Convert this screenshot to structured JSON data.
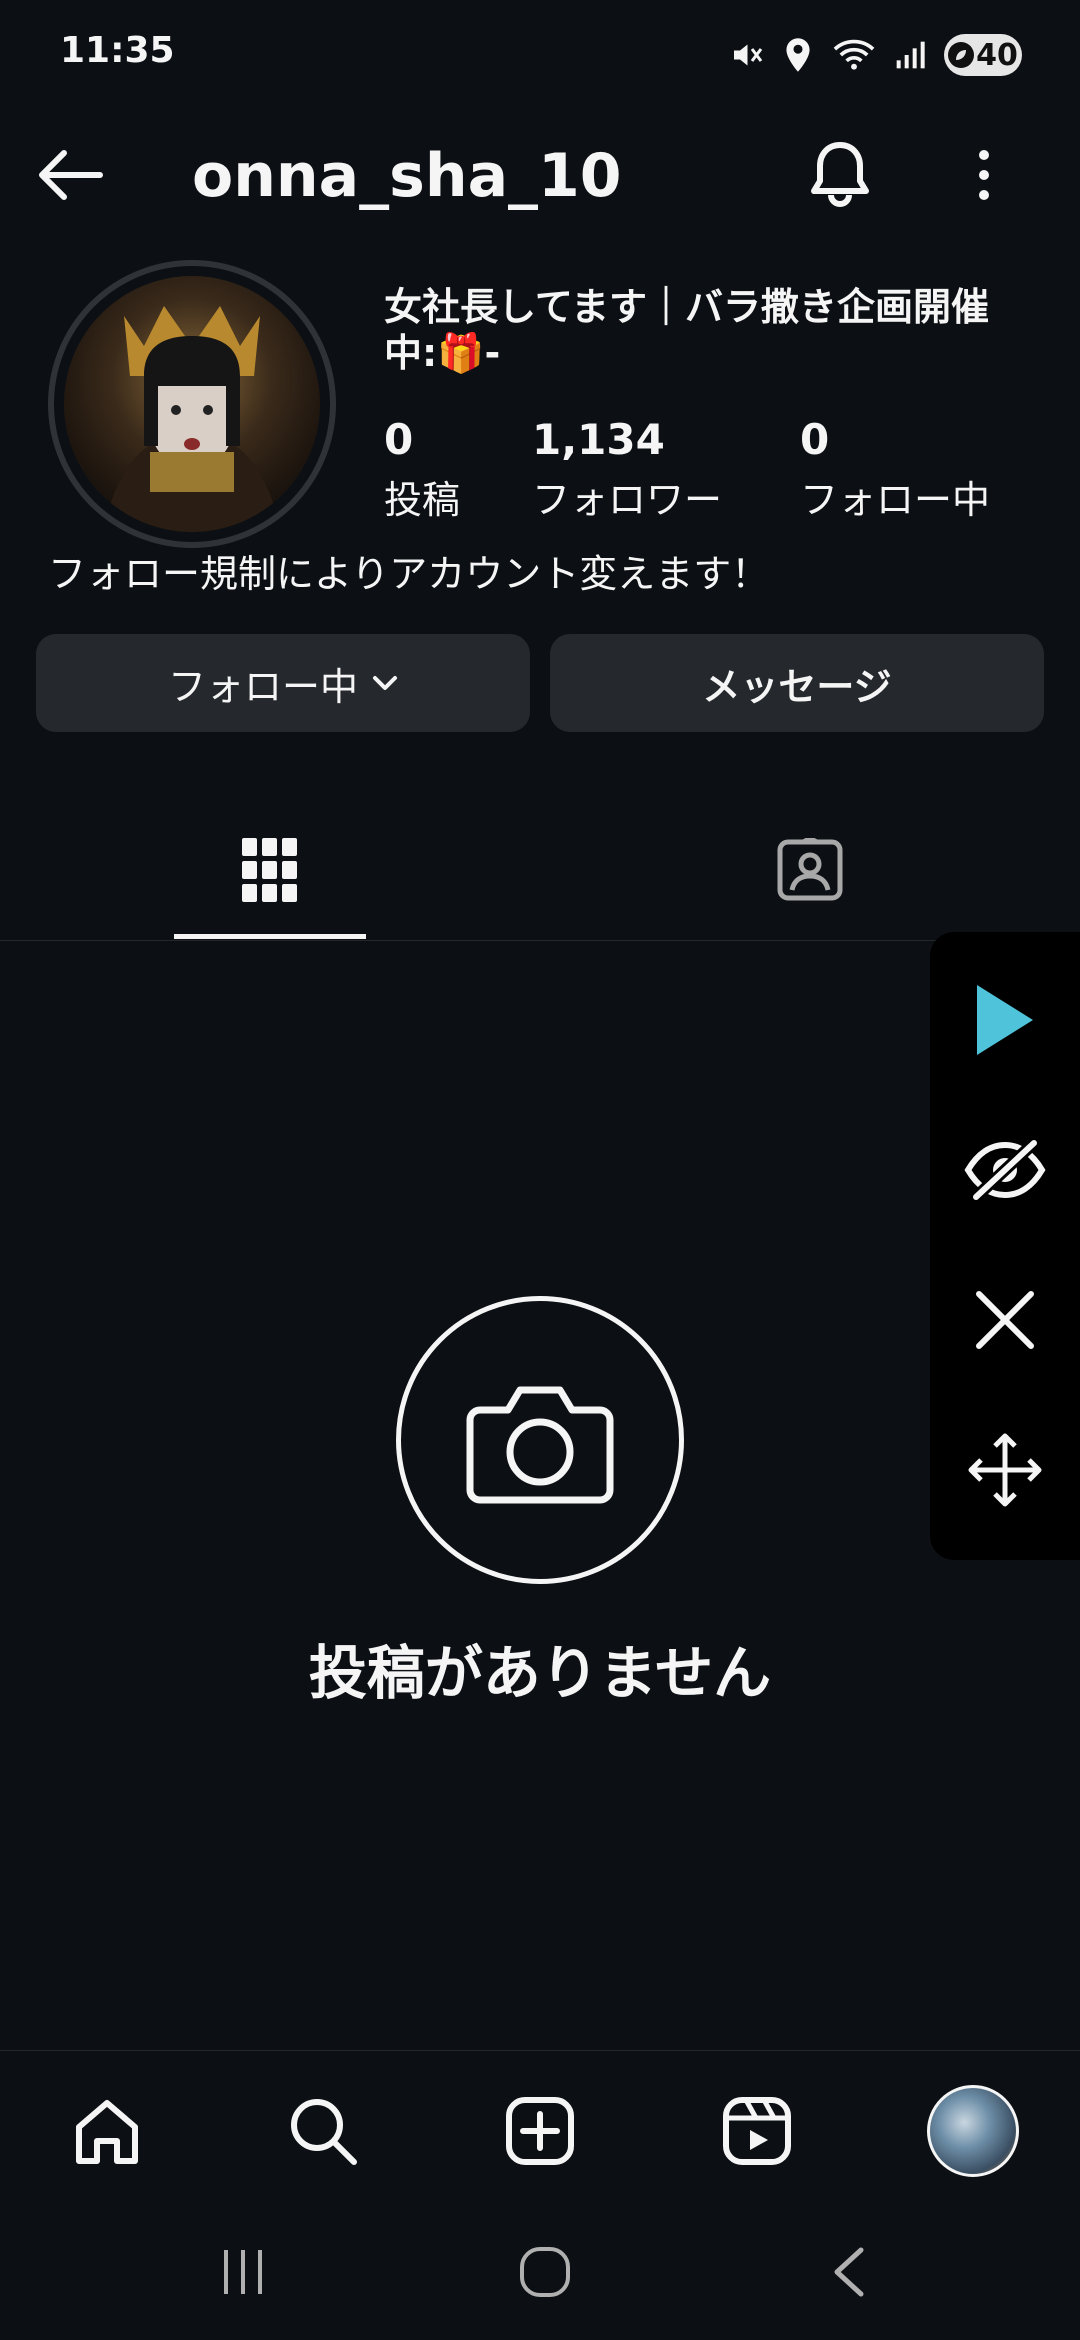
{
  "status_bar": {
    "time": "11:35",
    "battery": "40",
    "icons": [
      "mute-icon",
      "location-icon",
      "wifi-icon",
      "signal-icon",
      "battery-icon"
    ]
  },
  "header": {
    "username": "onna_sha_10",
    "icons": [
      "back-arrow-icon",
      "bell-icon",
      "more-vertical-icon"
    ]
  },
  "profile": {
    "full_name": "女社長してます｜バラ撒き企画開催中:🎁-",
    "stats": [
      {
        "value": "0",
        "label": "投稿"
      },
      {
        "value": "1,134",
        "label": "フォロワー"
      },
      {
        "value": "0",
        "label": "フォロー中"
      }
    ],
    "bio": "フォロー規制によりアカウント変えます！"
  },
  "actions": {
    "following_label": "フォロー中",
    "message_label": "メッセージ"
  },
  "tabs": {
    "items": [
      "grid-icon",
      "tagged-icon"
    ],
    "active": "grid-icon"
  },
  "empty_state": {
    "text": "投稿がありません",
    "icon": "camera-icon"
  },
  "overlay": {
    "buttons": [
      "play-icon",
      "hide-icon",
      "close-icon",
      "move-icon"
    ],
    "accent": "#4fc3d9"
  },
  "bottom_nav": {
    "items": [
      "home-icon",
      "search-icon",
      "create-icon",
      "reels-icon",
      "profile-avatar"
    ]
  },
  "system_nav": {
    "items": [
      "recents-icon",
      "home-circle-icon",
      "back-chevron-icon"
    ]
  },
  "colors": {
    "background": "#0c1014",
    "button_bg": "#25292e",
    "text": "#f5f5f5"
  }
}
